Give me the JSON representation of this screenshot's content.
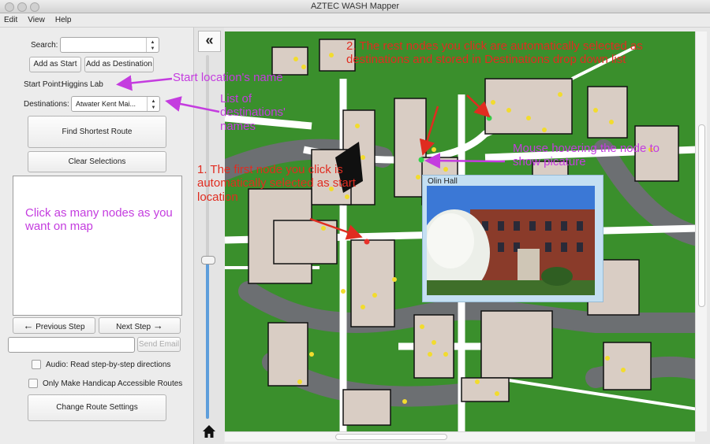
{
  "window": {
    "title": "AZTEC WASH Mapper"
  },
  "menu": {
    "items": [
      "Edit",
      "View",
      "Help"
    ]
  },
  "panel": {
    "search_label": "Search:",
    "search_value": "",
    "add_start_label": "Add as Start",
    "add_destination_label": "Add as Destination",
    "start_point_label": "Start Point:",
    "start_point_value": "Higgins Lab",
    "destinations_label": "Destinations:",
    "destinations_value": "Atwater Kent Mai...",
    "find_route_label": "Find Shortest Route",
    "clear_label": "Clear Selections",
    "prev_step_label": "Previous Step",
    "next_step_label": "Next Step",
    "email_value": "",
    "send_email_label": "Send Email",
    "audio_label": "Audio: Read step-by-step directions",
    "handicap_label": "Only Make Handicap Accessible Routes",
    "change_settings_label": "Change Route Settings"
  },
  "annotations": {
    "start_name": "Start location's name",
    "dest_names": "List of destinations' names",
    "click_nodes": "Click as many nodes as you want on map",
    "rest_nodes": "2. The rest nodes you click are automatically selected as destinations and stored in Destinations drop down list",
    "hover": "Mouse hovering the node to show picature",
    "first_node": "1. The first node you click is automatically selected as start location"
  },
  "popup": {
    "title": "Olin Hall"
  },
  "colors": {
    "grass": "#3a8f2c",
    "road": "#6c6f72",
    "path": "#ffffff",
    "building": "#d9cdc4",
    "node": "#f2dc2e",
    "start_node": "#e8322b",
    "hover_node": "#32d24a",
    "annotation_purple": "#c43cdf",
    "annotation_red": "#e02c20"
  },
  "icons": {
    "collapse": "double-chevron-left-icon",
    "home": "home-icon",
    "prev": "arrow-left-icon",
    "next": "arrow-right-icon"
  }
}
